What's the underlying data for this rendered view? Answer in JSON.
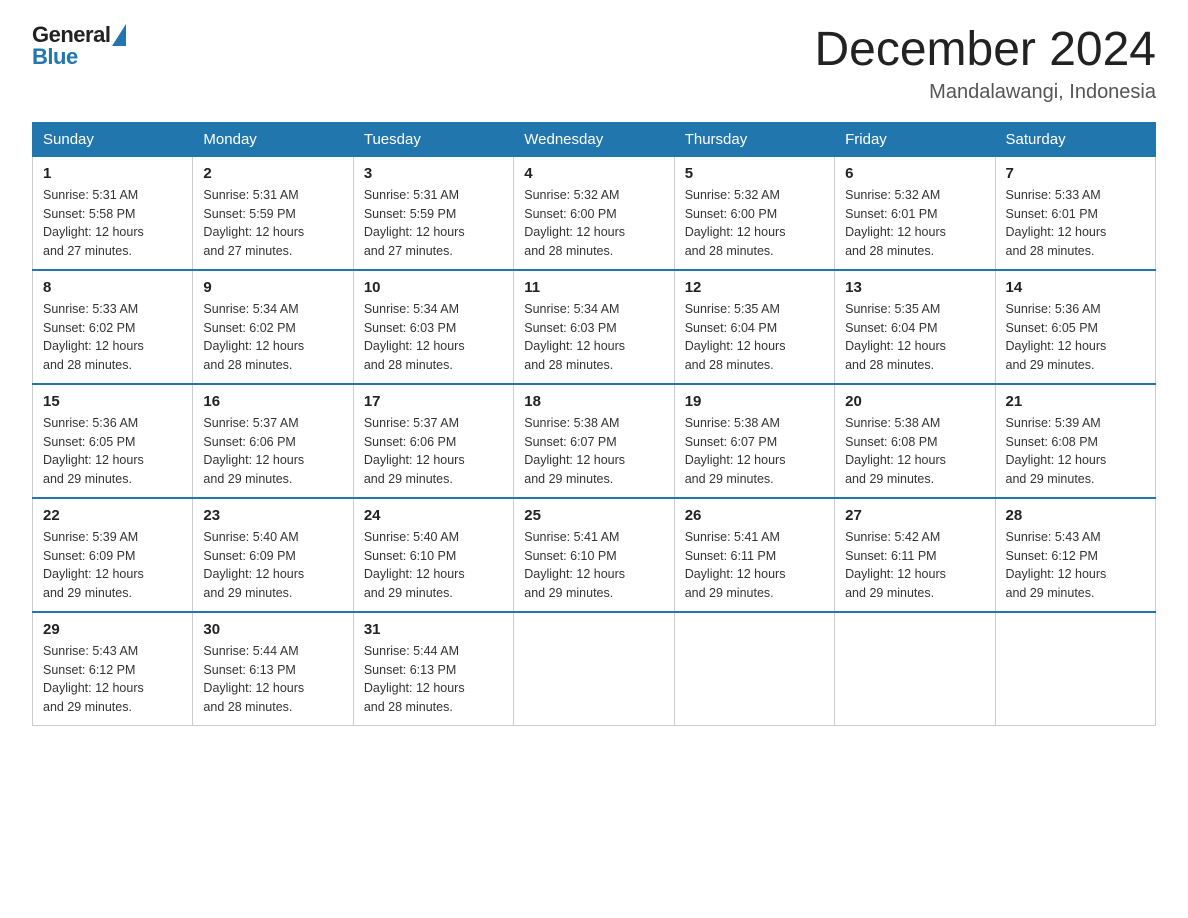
{
  "header": {
    "logo_general": "General",
    "logo_blue": "Blue",
    "title": "December 2024",
    "location": "Mandalawangi, Indonesia"
  },
  "weekdays": [
    "Sunday",
    "Monday",
    "Tuesday",
    "Wednesday",
    "Thursday",
    "Friday",
    "Saturday"
  ],
  "weeks": [
    [
      {
        "day": "1",
        "sunrise": "5:31 AM",
        "sunset": "5:58 PM",
        "daylight": "12 hours and 27 minutes."
      },
      {
        "day": "2",
        "sunrise": "5:31 AM",
        "sunset": "5:59 PM",
        "daylight": "12 hours and 27 minutes."
      },
      {
        "day": "3",
        "sunrise": "5:31 AM",
        "sunset": "5:59 PM",
        "daylight": "12 hours and 27 minutes."
      },
      {
        "day": "4",
        "sunrise": "5:32 AM",
        "sunset": "6:00 PM",
        "daylight": "12 hours and 28 minutes."
      },
      {
        "day": "5",
        "sunrise": "5:32 AM",
        "sunset": "6:00 PM",
        "daylight": "12 hours and 28 minutes."
      },
      {
        "day": "6",
        "sunrise": "5:32 AM",
        "sunset": "6:01 PM",
        "daylight": "12 hours and 28 minutes."
      },
      {
        "day": "7",
        "sunrise": "5:33 AM",
        "sunset": "6:01 PM",
        "daylight": "12 hours and 28 minutes."
      }
    ],
    [
      {
        "day": "8",
        "sunrise": "5:33 AM",
        "sunset": "6:02 PM",
        "daylight": "12 hours and 28 minutes."
      },
      {
        "day": "9",
        "sunrise": "5:34 AM",
        "sunset": "6:02 PM",
        "daylight": "12 hours and 28 minutes."
      },
      {
        "day": "10",
        "sunrise": "5:34 AM",
        "sunset": "6:03 PM",
        "daylight": "12 hours and 28 minutes."
      },
      {
        "day": "11",
        "sunrise": "5:34 AM",
        "sunset": "6:03 PM",
        "daylight": "12 hours and 28 minutes."
      },
      {
        "day": "12",
        "sunrise": "5:35 AM",
        "sunset": "6:04 PM",
        "daylight": "12 hours and 28 minutes."
      },
      {
        "day": "13",
        "sunrise": "5:35 AM",
        "sunset": "6:04 PM",
        "daylight": "12 hours and 28 minutes."
      },
      {
        "day": "14",
        "sunrise": "5:36 AM",
        "sunset": "6:05 PM",
        "daylight": "12 hours and 29 minutes."
      }
    ],
    [
      {
        "day": "15",
        "sunrise": "5:36 AM",
        "sunset": "6:05 PM",
        "daylight": "12 hours and 29 minutes."
      },
      {
        "day": "16",
        "sunrise": "5:37 AM",
        "sunset": "6:06 PM",
        "daylight": "12 hours and 29 minutes."
      },
      {
        "day": "17",
        "sunrise": "5:37 AM",
        "sunset": "6:06 PM",
        "daylight": "12 hours and 29 minutes."
      },
      {
        "day": "18",
        "sunrise": "5:38 AM",
        "sunset": "6:07 PM",
        "daylight": "12 hours and 29 minutes."
      },
      {
        "day": "19",
        "sunrise": "5:38 AM",
        "sunset": "6:07 PM",
        "daylight": "12 hours and 29 minutes."
      },
      {
        "day": "20",
        "sunrise": "5:38 AM",
        "sunset": "6:08 PM",
        "daylight": "12 hours and 29 minutes."
      },
      {
        "day": "21",
        "sunrise": "5:39 AM",
        "sunset": "6:08 PM",
        "daylight": "12 hours and 29 minutes."
      }
    ],
    [
      {
        "day": "22",
        "sunrise": "5:39 AM",
        "sunset": "6:09 PM",
        "daylight": "12 hours and 29 minutes."
      },
      {
        "day": "23",
        "sunrise": "5:40 AM",
        "sunset": "6:09 PM",
        "daylight": "12 hours and 29 minutes."
      },
      {
        "day": "24",
        "sunrise": "5:40 AM",
        "sunset": "6:10 PM",
        "daylight": "12 hours and 29 minutes."
      },
      {
        "day": "25",
        "sunrise": "5:41 AM",
        "sunset": "6:10 PM",
        "daylight": "12 hours and 29 minutes."
      },
      {
        "day": "26",
        "sunrise": "5:41 AM",
        "sunset": "6:11 PM",
        "daylight": "12 hours and 29 minutes."
      },
      {
        "day": "27",
        "sunrise": "5:42 AM",
        "sunset": "6:11 PM",
        "daylight": "12 hours and 29 minutes."
      },
      {
        "day": "28",
        "sunrise": "5:43 AM",
        "sunset": "6:12 PM",
        "daylight": "12 hours and 29 minutes."
      }
    ],
    [
      {
        "day": "29",
        "sunrise": "5:43 AM",
        "sunset": "6:12 PM",
        "daylight": "12 hours and 29 minutes."
      },
      {
        "day": "30",
        "sunrise": "5:44 AM",
        "sunset": "6:13 PM",
        "daylight": "12 hours and 28 minutes."
      },
      {
        "day": "31",
        "sunrise": "5:44 AM",
        "sunset": "6:13 PM",
        "daylight": "12 hours and 28 minutes."
      },
      null,
      null,
      null,
      null
    ]
  ],
  "labels": {
    "sunrise": "Sunrise:",
    "sunset": "Sunset:",
    "daylight": "Daylight:"
  }
}
